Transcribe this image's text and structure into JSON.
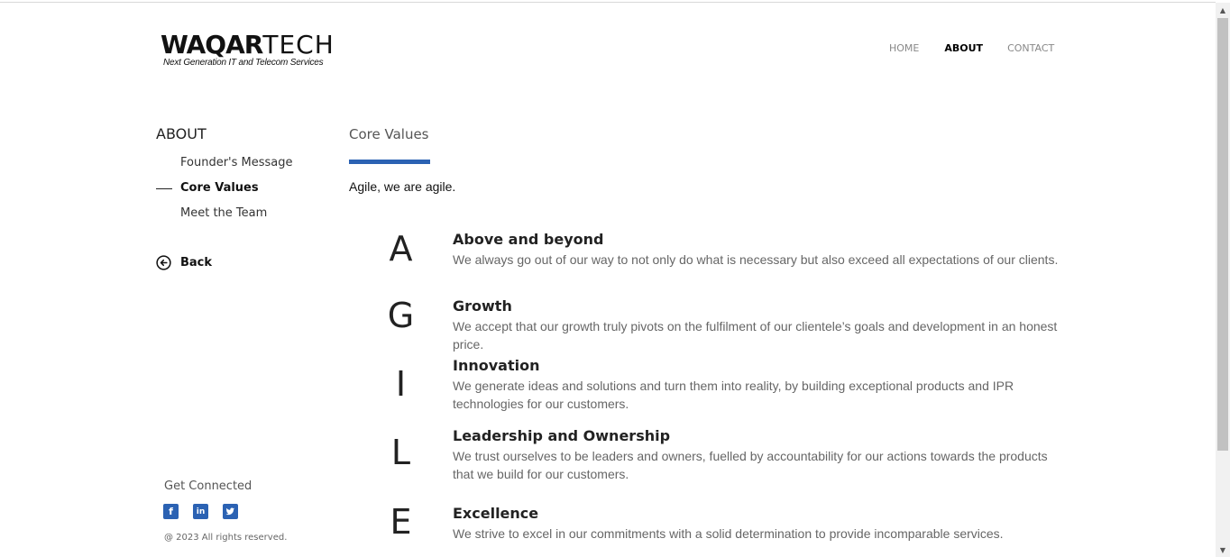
{
  "logo": {
    "main_bold": "WAQAR",
    "main_thin": "TECH",
    "tagline": "Next Generation IT and Telecom Services"
  },
  "nav": {
    "home": "HOME",
    "about": "ABOUT",
    "contact": "CONTACT"
  },
  "sidebar": {
    "title": "ABOUT",
    "items": [
      {
        "label": "Founder's Message"
      },
      {
        "label": "Core Values"
      },
      {
        "label": "Meet the Team"
      }
    ],
    "back": "Back",
    "get_connected": "Get Connected",
    "socials": [
      "facebook-icon",
      "linkedin-icon",
      "twitter-icon"
    ],
    "copyright": "@ 2023 All rights reserved."
  },
  "main": {
    "title": "Core Values",
    "intro": "Agile, we are agile.",
    "values": [
      {
        "letter": "A",
        "title": "Above and beyond",
        "desc": "We always go out of our way to not only do what is necessary but also exceed all expectations of our clients."
      },
      {
        "letter": "G",
        "title": "Growth",
        "desc": "We accept that our growth truly pivots on the fulfilment of our clientele’s goals and development in an honest price."
      },
      {
        "letter": "I",
        "title": "Innovation",
        "desc": "We generate ideas and solutions and turn them into reality, by building exceptional products and IPR technologies for our customers."
      },
      {
        "letter": "L",
        "title": "Leadership and Ownership",
        "desc": "We trust ourselves to be leaders and owners, fuelled by accountability for our actions towards the products that we build for our customers."
      },
      {
        "letter": "E",
        "title": "Excellence",
        "desc": "We strive to excel in our commitments with a solid determination to provide incomparable services."
      }
    ]
  },
  "colors": {
    "accent": "#2b62b3"
  }
}
